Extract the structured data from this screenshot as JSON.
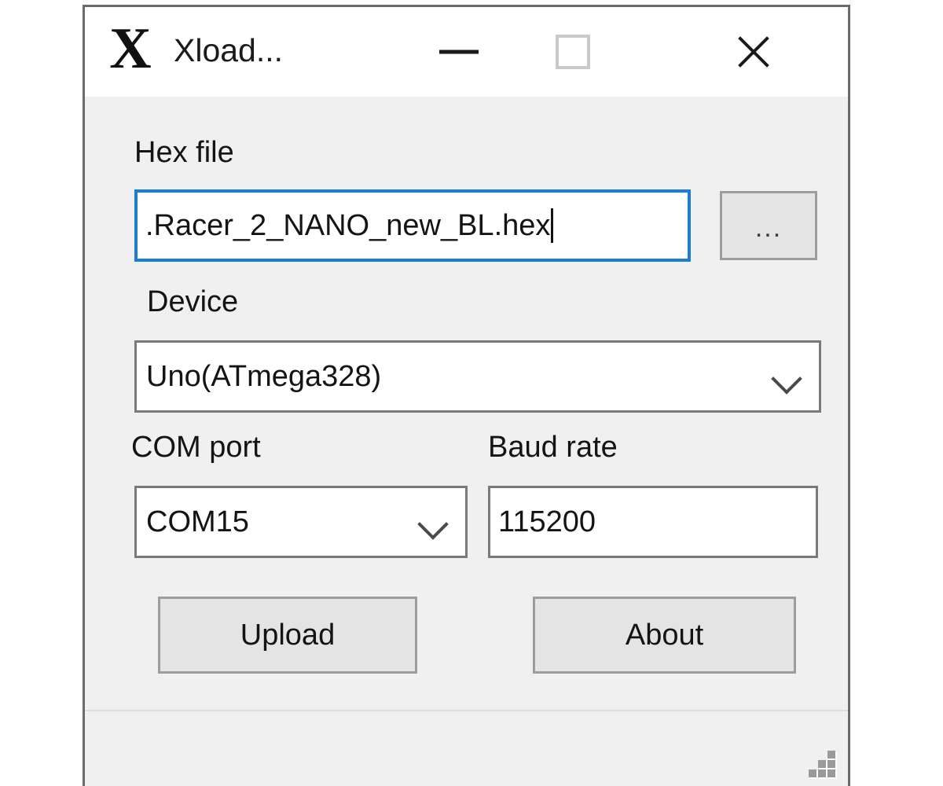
{
  "window": {
    "title": "Xload...",
    "logo_glyph": "X",
    "controls": {
      "minimize_label": "Minimize",
      "maximize_label": "Maximize",
      "close_label": "Close"
    }
  },
  "form": {
    "hex_file": {
      "label": "Hex file",
      "value": ".Racer_2_NANO_new_BL.hex",
      "placeholder": "",
      "focused": true,
      "browse_label": "..."
    },
    "device": {
      "label": "Device",
      "value": "Uno(ATmega328)",
      "options": [
        "Uno(ATmega328)"
      ]
    },
    "com_port": {
      "label": "COM port",
      "value": "COM15",
      "options": [
        "COM15"
      ]
    },
    "baud_rate": {
      "label": "Baud rate",
      "value": "115200",
      "placeholder": ""
    }
  },
  "actions": {
    "upload_label": "Upload",
    "about_label": "About"
  },
  "status": {
    "text": "",
    "grip_icon": "resize-grip-icon"
  },
  "colors": {
    "accent_focus": "#1a7fd4",
    "window_border": "#6b6b6b",
    "client_background": "#f0f0f0",
    "titlebar_background": "#ffffff",
    "button_face": "#e4e4e4",
    "control_border": "#7a7a7a",
    "text": "#141414"
  }
}
